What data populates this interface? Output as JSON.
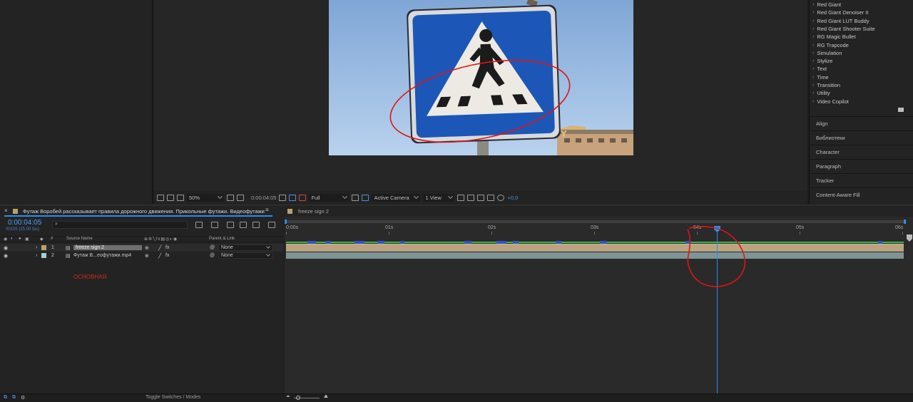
{
  "effects_list": [
    "Red Giant",
    "Red Giant Denoiser II",
    "Red Giant LUT Buddy",
    "Red Giant Shooter Suite",
    "RG Magic Bullet",
    "RG Trapcode",
    "Simulation",
    "Stylize",
    "Text",
    "Time",
    "Transition",
    "Utility",
    "Video Copilot"
  ],
  "right_tabs": [
    "Align",
    "Библиотеки",
    "Character",
    "Paragraph",
    "Tracker",
    "Content-Aware Fill"
  ],
  "viewer_toolbar": {
    "zoom": "50%",
    "timecode": "0:00:04:05",
    "resolution": "Full",
    "camera": "Active Camera",
    "view": "1 View",
    "exposure": "+0,0"
  },
  "timeline": {
    "comp_tab": "Футаж Воробей рассказывает правила дорожного движения. Прикольные футажи. Видеофутажи",
    "second_tab": "freeze sign 2",
    "current_time": "0:00:04:05",
    "frame_info": "00105 (25.00 fps)",
    "search_placeholder": "",
    "col_source_name": "Source Name",
    "col_parent": "Parent & Link",
    "col_number": "#",
    "layers": [
      {
        "num": "1",
        "name": "freeze sign 2",
        "parent": "None",
        "label_color": "#b9a16c"
      },
      {
        "num": "2",
        "name": "Футаж В...еофутажи.mp4",
        "parent": "None",
        "label_color": "#9fd1d1"
      }
    ],
    "annotation": "ОСНОВНАЯ",
    "ruler": [
      "0:00s",
      "01s",
      "02s",
      "03s",
      "04s",
      "05s",
      "06s"
    ],
    "toggle_label": "Toggle Switches / Modes"
  },
  "colors": {
    "accent_blue": "#2d8ceb",
    "annotation_red": "#d42a1a"
  }
}
